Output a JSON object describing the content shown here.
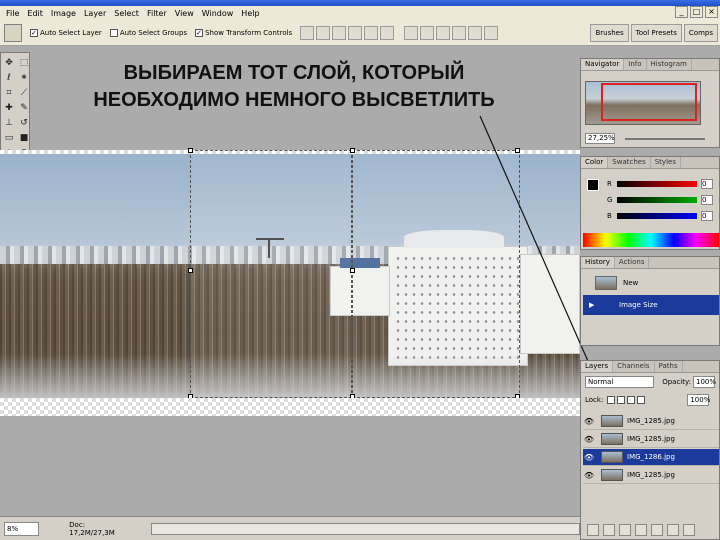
{
  "menu": [
    "File",
    "Edit",
    "Image",
    "Layer",
    "Select",
    "Filter",
    "View",
    "Window",
    "Help"
  ],
  "options": {
    "auto_select_layer": "Auto Select Layer",
    "auto_select_groups": "Auto Select Groups",
    "show_transform_controls": "Show Transform Controls"
  },
  "palette_well": [
    "Brushes",
    "Tool Presets",
    "Comps"
  ],
  "annotation": {
    "line1": "ВЫБИРАЕМ ТОТ СЛОЙ, КОТОРЫЙ",
    "line2": "НЕОБХОДИМО НЕМНОГО ВЫСВЕТЛИТЬ"
  },
  "status": {
    "zoom": "8%",
    "doc": "Doc: 17,2M/27,3M"
  },
  "navigator": {
    "tabs": [
      "Navigator",
      "Info",
      "Histogram"
    ],
    "zoom": "27,25%"
  },
  "color_panel": {
    "tabs": [
      "Color",
      "Swatches",
      "Styles"
    ],
    "channels": [
      {
        "label": "R",
        "value": "0"
      },
      {
        "label": "G",
        "value": "0"
      },
      {
        "label": "B",
        "value": "0"
      }
    ]
  },
  "history": {
    "tabs": [
      "History",
      "Actions"
    ],
    "items": [
      {
        "label": "New",
        "selected": false
      },
      {
        "label": "Image Size",
        "selected": true
      }
    ]
  },
  "layers": {
    "tabs": [
      "Layers",
      "Channels",
      "Paths"
    ],
    "blend_mode": "Normal",
    "opacity_label": "Opacity:",
    "opacity": "100%",
    "lock_label": "Lock:",
    "fill": "100%",
    "items": [
      {
        "name": "IMG_1285.jpg",
        "selected": false
      },
      {
        "name": "IMG_1285.jpg",
        "selected": false
      },
      {
        "name": "IMG_1286.jpg",
        "selected": true
      },
      {
        "name": "IMG_1285.jpg",
        "selected": false
      }
    ]
  },
  "colors": {
    "menu_bg": "#ece9d8",
    "selection": "#1c3a9c",
    "title_bar": "#2a5fd8",
    "annotation_text": "#111111"
  }
}
